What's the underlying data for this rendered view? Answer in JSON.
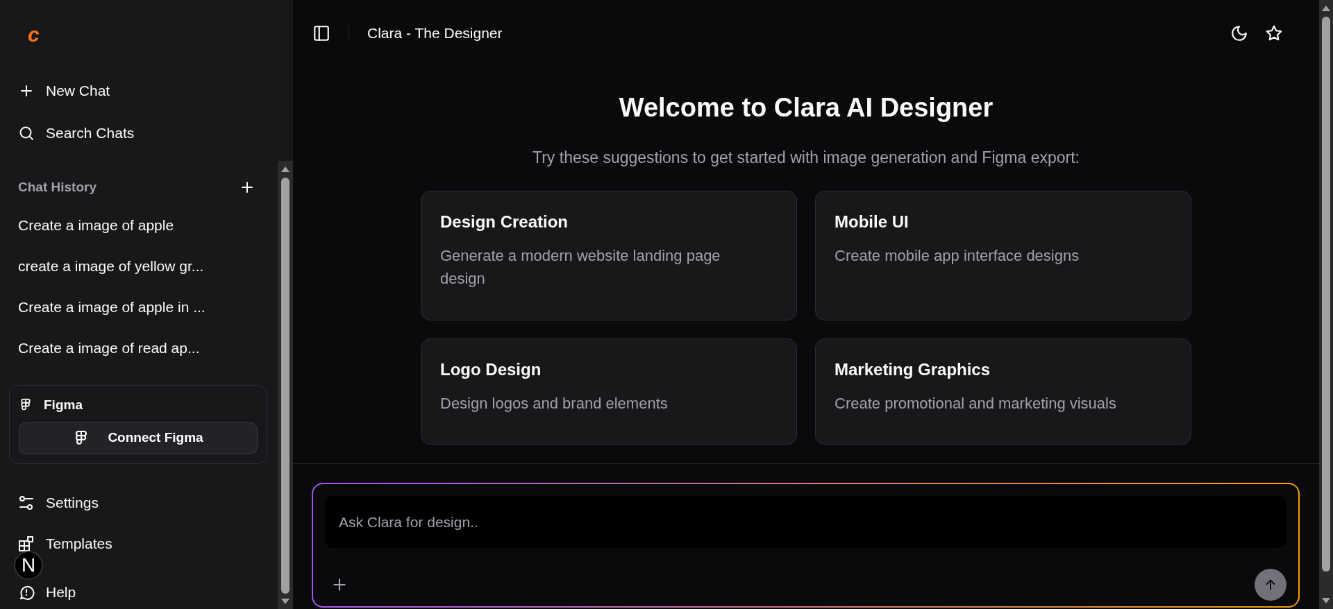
{
  "sidebar": {
    "logo": "c",
    "actions": [
      {
        "kind": "new",
        "label": "New Chat"
      },
      {
        "kind": "search",
        "label": "Search Chats"
      }
    ],
    "history_title": "Chat History",
    "history": [
      "Create a image of apple",
      "create a image of yellow gr...",
      "Create a image of apple in ...",
      "Create a image of read ap..."
    ],
    "figma": {
      "title": "Figma",
      "button": "Connect Figma"
    },
    "footer": [
      {
        "kind": "settings",
        "label": "Settings"
      },
      {
        "kind": "templates",
        "label": "Templates"
      },
      {
        "kind": "help",
        "label": "Help"
      }
    ]
  },
  "floating_badge": "N",
  "header": {
    "title": "Clara - The Designer"
  },
  "welcome": {
    "title": "Welcome to Clara AI Designer",
    "subtitle": "Try these suggestions to get started with image generation and Figma export:"
  },
  "suggestions": [
    {
      "title": "Design Creation",
      "description": "Generate a modern website landing page design"
    },
    {
      "title": "Mobile UI",
      "description": "Create mobile app interface designs"
    },
    {
      "title": "Logo Design",
      "description": "Design logos and brand elements"
    },
    {
      "title": "Marketing Graphics",
      "description": "Create promotional and marketing visuals"
    }
  ],
  "composer": {
    "placeholder": "Ask Clara for design.."
  }
}
